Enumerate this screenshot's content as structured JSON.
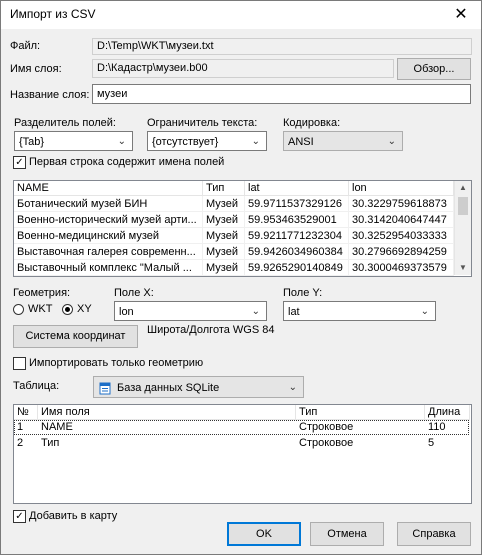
{
  "dialog": {
    "title": "Импорт из CSV",
    "close_glyph": "✕"
  },
  "file": {
    "label": "Файл:",
    "value": "D:\\Temp\\WKT\\музеи.txt"
  },
  "layer": {
    "label": "Имя слоя:",
    "value": "D:\\Кадастр\\музеи.b00",
    "browse_label": "Обзор..."
  },
  "layer_name": {
    "label": "Название слоя:",
    "value": "музеи"
  },
  "field_sep": {
    "label": "Разделитель полей:",
    "value": "{Tab}"
  },
  "text_delim": {
    "label": "Ограничитель текста:",
    "value": "{отсутствует}"
  },
  "encoding": {
    "label": "Кодировка:",
    "value": "ANSI"
  },
  "first_row": {
    "label": "Первая строка содержит имена полей",
    "checked": true
  },
  "preview": {
    "headers": [
      "NAME",
      "Тип",
      "lat",
      "lon"
    ],
    "rows": [
      [
        "Ботанический музей БИН",
        "Музей",
        "59.9711537329126",
        "30.3229759618873"
      ],
      [
        "Военно-исторический музей арти...",
        "Музей",
        "59.953463529001",
        "30.3142040647447"
      ],
      [
        "Военно-медицинский музей",
        "Музей",
        "59.9211771232304",
        "30.3252954033333"
      ],
      [
        "Выставочная галерея современн...",
        "Музей",
        "59.9426034960384",
        "30.2796692894259"
      ],
      [
        "Выставочный комплекс \"Малый ...",
        "Музей",
        "59.9265290140849",
        "30.3000469373579"
      ]
    ]
  },
  "geometry": {
    "label": "Геометрия:",
    "options": [
      "WKT",
      "XY"
    ],
    "selected": "XY",
    "x_label": "Поле X:",
    "x_value": "lon",
    "y_label": "Поле Y:",
    "y_value": "lat",
    "crs_button": "Система координат",
    "crs_value": "Широта/Долгота WGS 84"
  },
  "geometry_only": {
    "label": "Импортировать только геометрию",
    "checked": false
  },
  "table": {
    "label": "Таблица:",
    "value": "База данных SQLite"
  },
  "fields": {
    "headers": [
      "№",
      "Имя поля",
      "Тип",
      "Длина"
    ],
    "rows": [
      [
        "1",
        "NAME",
        "Строковое",
        "110"
      ],
      [
        "2",
        "Тип",
        "Строковое",
        "5"
      ]
    ]
  },
  "add_to_map": {
    "label": "Добавить в карту",
    "checked": true
  },
  "buttons": {
    "ok": "OK",
    "cancel": "Отмена",
    "help": "Справка"
  }
}
